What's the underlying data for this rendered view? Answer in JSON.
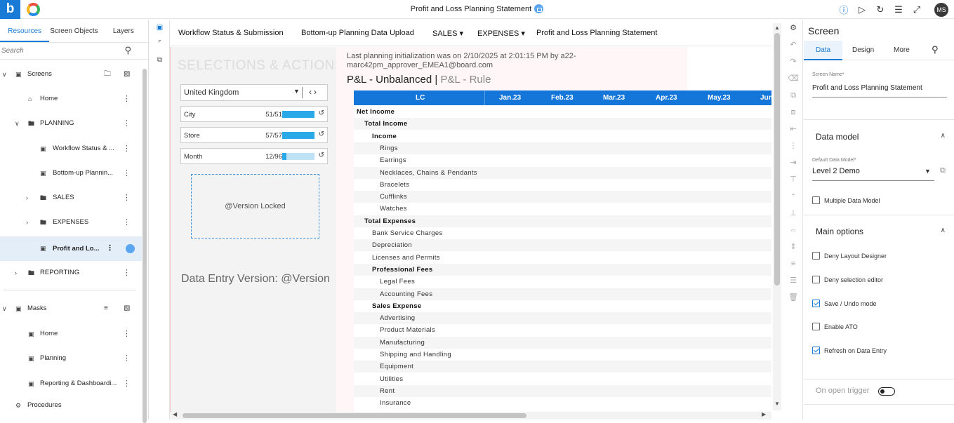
{
  "header": {
    "title": "Profit and Loss Planning Statement",
    "user_initials": "MS",
    "icons": [
      "info-icon",
      "play-icon",
      "refresh-icon",
      "tree-icon",
      "expand-icon"
    ]
  },
  "left_panel": {
    "tabs": [
      "Resources",
      "Screen Objects",
      "Layers"
    ],
    "search_placeholder": "Search",
    "tree": {
      "screens_label": "Screens",
      "home": "Home",
      "planning": "PLANNING",
      "workflow": "Workflow Status & ...",
      "bottomup": "Bottom-up Plannin...",
      "sales": "SALES",
      "expenses": "EXPENSES",
      "pnl": "Profit and Lo...",
      "reporting": "REPORTING",
      "masks_label": "Masks",
      "mask_home": "Home",
      "mask_planning": "Planning",
      "mask_reporting": "Reporting & Dashboardi...",
      "procedures": "Procedures"
    }
  },
  "nav": {
    "items": [
      "Workflow Status & Submission",
      "Bottom-up Planning Data Upload",
      "SALES ▾",
      "EXPENSES ▾",
      "Profit and Loss Planning Statement"
    ]
  },
  "selections": {
    "title": "SELECTIONS & ACTIONS",
    "country": "United Kingdom",
    "entities": [
      {
        "name": "City",
        "count": "51/51",
        "fill": 1.0
      },
      {
        "name": "Store",
        "count": "57/57",
        "fill": 1.0
      },
      {
        "name": "Month",
        "count": "12/96",
        "fill": 0.125
      }
    ],
    "locked_label": "@Version Locked",
    "data_entry_version": "Data Entry Version: @Version"
  },
  "report": {
    "info_line1": "Last planning initialization was on 2/10/2025 at 2:01:15 PM by a22-",
    "info_line2": "marc42pm_approver_EMEA1@board.com",
    "title_main": "P&L - Unbalanced",
    "title_sep": "|",
    "title_rule": "P&L - Rule",
    "columns": [
      "LC",
      "Jan.23",
      "Feb.23",
      "Mar.23",
      "Apr.23",
      "May.23",
      "Jun"
    ],
    "rows": [
      {
        "label": "Net Income",
        "level": 0,
        "bold": true
      },
      {
        "label": "Total Income",
        "level": 1,
        "bold": true
      },
      {
        "label": "Income",
        "level": 2,
        "bold": true
      },
      {
        "label": "Rings",
        "level": 3,
        "bold": false
      },
      {
        "label": "Earrings",
        "level": 3,
        "bold": false
      },
      {
        "label": "Necklaces, Chains & Pendants",
        "level": 3,
        "bold": false
      },
      {
        "label": "Bracelets",
        "level": 3,
        "bold": false
      },
      {
        "label": "Cufflinks",
        "level": 3,
        "bold": false
      },
      {
        "label": "Watches",
        "level": 3,
        "bold": false
      },
      {
        "label": "Total Expenses",
        "level": 1,
        "bold": true
      },
      {
        "label": "Bank Service Charges",
        "level": 2,
        "bold": false
      },
      {
        "label": "Depreciation",
        "level": 2,
        "bold": false
      },
      {
        "label": "Licenses and Permits",
        "level": 2,
        "bold": false
      },
      {
        "label": "Professional Fees",
        "level": 2,
        "bold": true
      },
      {
        "label": "Legal Fees",
        "level": 3,
        "bold": false
      },
      {
        "label": "Accounting Fees",
        "level": 3,
        "bold": false
      },
      {
        "label": "Sales Expense",
        "level": 2,
        "bold": true
      },
      {
        "label": "Advertising",
        "level": 3,
        "bold": false
      },
      {
        "label": "Product Materials",
        "level": 3,
        "bold": false
      },
      {
        "label": "Manufacturing",
        "level": 3,
        "bold": false
      },
      {
        "label": "Shipping and Handling",
        "level": 3,
        "bold": false
      },
      {
        "label": "Equipment",
        "level": 3,
        "bold": false
      },
      {
        "label": "Utilities",
        "level": 3,
        "bold": false
      },
      {
        "label": "Rent",
        "level": 3,
        "bold": false
      },
      {
        "label": "Insurance",
        "level": 3,
        "bold": false
      }
    ]
  },
  "right_panel": {
    "title": "Screen",
    "tabs": [
      "Data",
      "Design",
      "More"
    ],
    "screen_name_label": "Screen Name*",
    "screen_name_value": "Profit and Loss Planning Statement",
    "data_model_header": "Data model",
    "default_dm_label": "Default Data Model*",
    "default_dm_value": "Level 2 Demo",
    "multiple_dm": "Multiple Data Model",
    "main_options_header": "Main options",
    "options": [
      {
        "label": "Deny Layout Designer",
        "checked": false
      },
      {
        "label": "Deny selection editor",
        "checked": false
      },
      {
        "label": "Save / Undo mode",
        "checked": true
      },
      {
        "label": "Enable ATO",
        "checked": false
      },
      {
        "label": "Refresh on Data Entry",
        "checked": true
      }
    ],
    "on_open_trigger": "On open trigger"
  },
  "colors": {
    "accent": "#1a7bd6",
    "grid_header": "#1476d8",
    "bar_fill": "#2aa9e8"
  }
}
